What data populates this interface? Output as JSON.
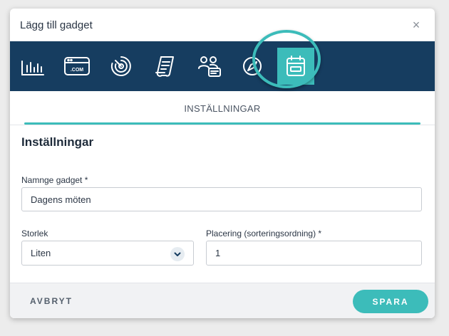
{
  "dialog": {
    "title": "Lägg till gadget",
    "close_label": "×"
  },
  "iconbar": {
    "background_color": "#163d60",
    "active_color": "#3cbcba",
    "icons": [
      {
        "name": "bar-chart-icon"
      },
      {
        "name": "dot-com-icon"
      },
      {
        "name": "target-icon"
      },
      {
        "name": "document-icon"
      },
      {
        "name": "users-chat-icon"
      },
      {
        "name": "compass-icon"
      },
      {
        "name": "calendar-icon",
        "active": true
      }
    ]
  },
  "tabs": [
    {
      "label": "INSTÄLLNINGAR",
      "active": true
    }
  ],
  "form": {
    "section_title": "Inställningar",
    "name_label": "Namnge gadget *",
    "name_value": "Dagens möten",
    "size_label": "Storlek",
    "size_value": "Liten",
    "placement_label": "Placering (sorteringsordning) *",
    "placement_value": "1"
  },
  "footer": {
    "cancel_label": "AVBRYT",
    "save_label": "SPARA"
  }
}
